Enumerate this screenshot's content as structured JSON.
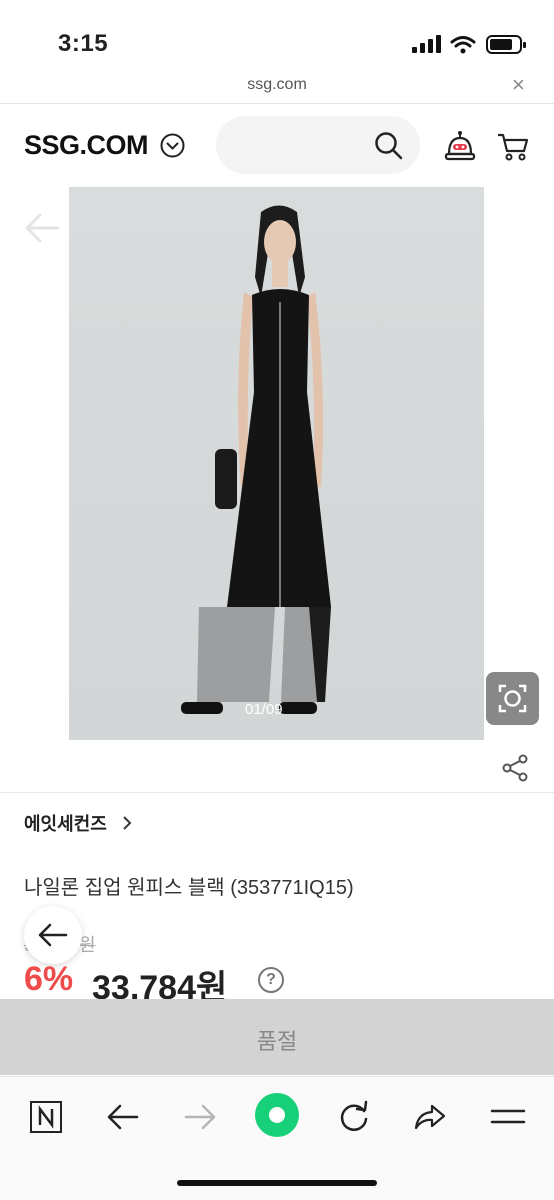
{
  "status_bar": {
    "time": "3:15"
  },
  "browser": {
    "url": "ssg.com",
    "close_label": "×"
  },
  "header": {
    "logo": "SSG.COM"
  },
  "product": {
    "image_counter": "01/09",
    "brand": "에잇세컨즈",
    "title": "나일론 집업 원피스 블랙 (353771IQ15)",
    "original_price": "35,940원",
    "discount": "6%",
    "price": "33,784원",
    "help": "?"
  },
  "purchase": {
    "soldout_label": "품절"
  },
  "toolbar": {
    "items": [
      "naver-icon",
      "back-arrow-icon",
      "forward-arrow-icon",
      "home-icon",
      "refresh-icon",
      "share-icon",
      "menu-icon"
    ]
  },
  "colors": {
    "discount": "#ef4b4b",
    "home_button": "#19d07a"
  }
}
